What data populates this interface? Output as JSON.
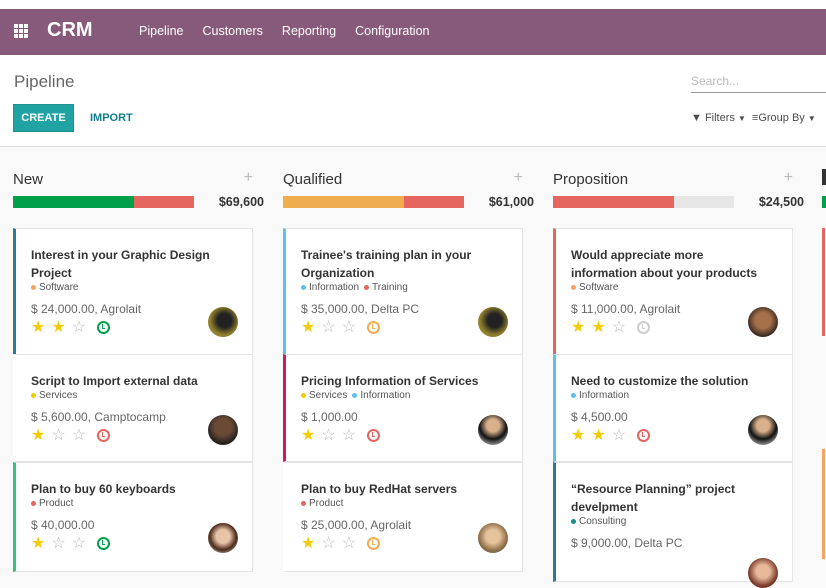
{
  "app": {
    "title": "CRM",
    "menu": [
      "Pipeline",
      "Customers",
      "Reporting",
      "Configuration"
    ]
  },
  "control_panel": {
    "breadcrumb": "Pipeline",
    "create_label": "CREATE",
    "import_label": "IMPORT",
    "search_placeholder": "Search...",
    "filters_label": "Filters",
    "groupby_label": "Group By"
  },
  "colors": {
    "navbar": "#875a7b",
    "primary": "#21a3a3",
    "green": "#00a04a",
    "orange": "#f0ad4e",
    "red": "#e4665f",
    "grey": "#e6e6e6"
  },
  "columns": [
    {
      "title": "New",
      "total": "$69,600",
      "progress": [
        {
          "color": "#00a04a",
          "fraction": 0.67
        },
        {
          "color": "#e4665f",
          "fraction": 0.33
        }
      ],
      "cards": [
        {
          "title": "Interest in your Graphic Design Project",
          "tags": [
            {
              "label": "Software",
              "color": "#f4a460"
            }
          ],
          "amount": "$ 24,000.00, Agrolait",
          "stars": 2,
          "activity": "green",
          "border": "#2f7a93",
          "avatar": "woman-dark-hair"
        },
        {
          "title": "Script to Import external data",
          "tags": [
            {
              "label": "Services",
              "color": "#f3cc00"
            }
          ],
          "amount": "$ 5,600.00, Camptocamp",
          "stars": 1,
          "activity": "red",
          "border": "transparent",
          "avatar": "man-bald"
        },
        {
          "title": "Plan to buy 60 keyboards",
          "tags": [
            {
              "label": "Product",
              "color": "#e4665f"
            }
          ],
          "amount": "$ 40,000.00",
          "stars": 1,
          "activity": "green",
          "border": "#30c381",
          "avatar": "woman-curly-hair"
        }
      ]
    },
    {
      "title": "Qualified",
      "total": "$61,000",
      "progress": [
        {
          "color": "#f0ad4e",
          "fraction": 0.67
        },
        {
          "color": "#e4665f",
          "fraction": 0.33
        }
      ],
      "cards": [
        {
          "title": "Trainee's training plan in your Organization",
          "tags": [
            {
              "label": "Information",
              "color": "#5bc0eb"
            },
            {
              "label": "Training",
              "color": "#e4665f"
            }
          ],
          "amount": "$ 35,000.00, Delta PC",
          "stars": 1,
          "activity": "orange",
          "border": "#5bc0eb",
          "avatar": "woman-dark-hair"
        },
        {
          "title": "Pricing Information of Services",
          "tags": [
            {
              "label": "Services",
              "color": "#f3cc00"
            },
            {
              "label": "Information",
              "color": "#5bc0eb"
            }
          ],
          "amount": "$ 1,000.00",
          "stars": 1,
          "activity": "red",
          "border": "#d6145f",
          "avatar": "man-suit"
        },
        {
          "title": "Plan to buy RedHat servers",
          "tags": [
            {
              "label": "Product",
              "color": "#e4665f"
            }
          ],
          "amount": "$ 25,000.00, Agrolait",
          "stars": 1,
          "activity": "orange",
          "border": "transparent",
          "avatar": "woman-blonde"
        }
      ]
    },
    {
      "title": "Proposition",
      "total": "$24,500",
      "progress": [
        {
          "color": "#e4665f",
          "fraction": 0.67
        },
        {
          "color": "#e6e6e6",
          "fraction": 0.33
        }
      ],
      "cards": [
        {
          "title": "Would appreciate more information about your products",
          "tags": [
            {
              "label": "Software",
              "color": "#f4a460"
            }
          ],
          "amount": "$ 11,000.00, Agrolait",
          "stars": 2,
          "activity": "grey",
          "border": "#e4665f",
          "avatar": "man-glasses"
        },
        {
          "title": "Need to customize the solution",
          "tags": [
            {
              "label": "Information",
              "color": "#5bc0eb"
            }
          ],
          "amount": "$ 4,500.00",
          "stars": 2,
          "activity": "red",
          "border": "#5bc0eb",
          "avatar": "man-suit"
        },
        {
          "title": "“Resource Planning” project develpment",
          "tags": [
            {
              "label": "Consulting",
              "color": "#1a8a8a"
            }
          ],
          "amount": "$ 9,000.00, Delta PC",
          "stars": 0,
          "activity": "none",
          "border": "#2f7a93",
          "avatar": "woman-brown-hair"
        }
      ]
    }
  ]
}
